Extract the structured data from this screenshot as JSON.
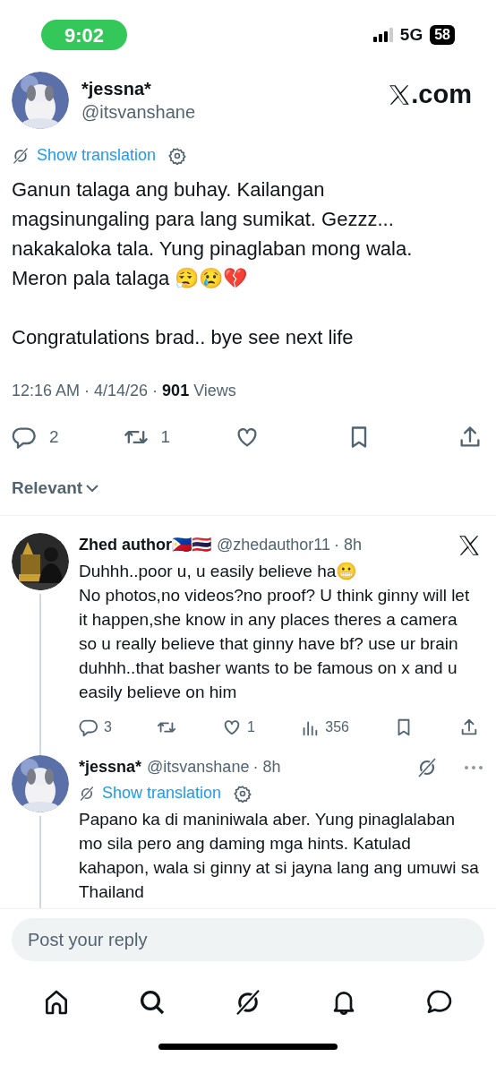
{
  "status_bar": {
    "time": "9:02",
    "network": "5G",
    "battery": "58"
  },
  "post": {
    "author": {
      "name": "*jessna*",
      "handle": "@itsvanshane"
    },
    "site": ".com",
    "translation": "Show translation",
    "paragraphs": [
      "Ganun talaga ang buhay. Kailangan magsinungaling para lang sumikat. Gezzz... nakakaloka tala. Yung pinaglaban mong wala. Meron pala talaga 😮‍💨😢💔",
      "Congratulations brad.. bye see next life"
    ],
    "meta": "12:16 AM · 4/14/26 · **901** Views",
    "actions": [
      {
        "kind": "reply",
        "count": "2"
      },
      {
        "kind": "repost",
        "count": "1"
      },
      {
        "kind": "like"
      },
      {
        "kind": "bookmark"
      },
      {
        "kind": "share"
      }
    ]
  },
  "sort": {
    "label": "Relevant"
  },
  "replies": [
    {
      "avatar": {
        "kind": "picture"
      },
      "name": "Zhed author🇵🇭🇹🇭",
      "handle": "@zhedauthor11",
      "age": "· 8h",
      "corner_icons": [
        {
          "kind": "x"
        }
      ],
      "text": "Duhhh..poor u, u easily believe ha😬\nNo photos,no videos?no proof? U think ginny will let it happen,she know in any places theres a camera so u really believe that ginny have bf? use ur brain duhhh..that basher wants to be famous on x and u easily believe on him",
      "actions": [
        {
          "kind": "reply",
          "count": "3"
        },
        {
          "kind": "repost"
        },
        {
          "kind": "like",
          "count": "1"
        },
        {
          "kind": "views",
          "count": "356"
        },
        {
          "kind": "bookmark"
        },
        {
          "kind": "share"
        }
      ]
    },
    {
      "avatar": {
        "kind": "picture"
      },
      "name": "*jessna*",
      "handle": "@itsvanshane",
      "age": "· 8h",
      "corner_icons": [
        {
          "kind": "grok"
        },
        {
          "kind": "more"
        }
      ],
      "translation": "Show translation",
      "text": "Papano ka di maniniwala aber. Yung pinaglalaban mo sila pero ang daming mga hints. Katulad kahapon, wala si ginny at si jayna lang ang umuwi sa Thailand"
    }
  ],
  "reply_field": {
    "placeholder": "Post your reply"
  },
  "nav": [
    {
      "kind": "home"
    },
    {
      "kind": "search"
    },
    {
      "kind": "grok"
    },
    {
      "kind": "notifications"
    },
    {
      "kind": "messages"
    }
  ]
}
